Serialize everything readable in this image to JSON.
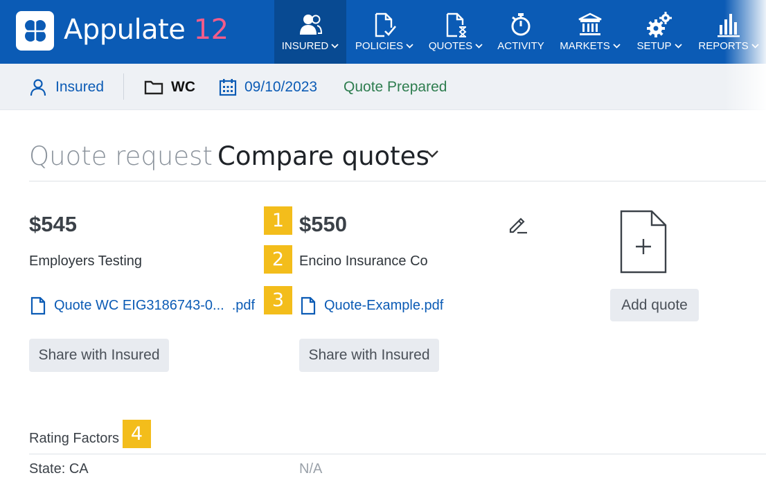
{
  "app": {
    "brand_name": "Appulate",
    "brand_version": "12"
  },
  "nav": [
    {
      "label": "INSURED",
      "icon": "users-icon",
      "active": true
    },
    {
      "label": "POLICIES",
      "icon": "document-check-icon",
      "active": false
    },
    {
      "label": "QUOTES",
      "icon": "document-hourglass-icon",
      "active": false
    },
    {
      "label": "ACTIVITY",
      "icon": "stopwatch-icon",
      "active": false
    },
    {
      "label": "MARKETS",
      "icon": "bank-icon",
      "active": false
    },
    {
      "label": "SETUP",
      "icon": "gears-icon",
      "active": false
    },
    {
      "label": "REPORTS",
      "icon": "bar-chart-icon",
      "active": false
    }
  ],
  "subheader": {
    "insured_label": "Insured",
    "line_of_business": "WC",
    "date": "09/10/2023",
    "status": "Quote Prepared"
  },
  "page": {
    "title_muted": "Quote request",
    "title_main": "Compare quotes"
  },
  "quotes": [
    {
      "price": "$545",
      "carrier": "Employers Testing",
      "document_name": "Quote WC EIG3186743-0...",
      "document_ext": ".pdf",
      "share_label": "Share with Insured"
    },
    {
      "price": "$550",
      "carrier": "Encino Insurance Co",
      "document_name": "Quote-Example.pdf",
      "share_label": "Share with Insured"
    }
  ],
  "add_quote_label": "Add quote",
  "badges": [
    "1",
    "2",
    "3",
    "4"
  ],
  "rating_factors": {
    "label": "Rating Factors",
    "rows": [
      {
        "name": "State: CA",
        "value": "N/A"
      }
    ]
  },
  "colors": {
    "nav_bg": "#0b5bb5",
    "nav_active": "#084a92",
    "brand_accent": "#f25c8a",
    "link": "#0b5bb5",
    "status_green": "#2e7d4f",
    "badge": "#f3bd1b"
  }
}
